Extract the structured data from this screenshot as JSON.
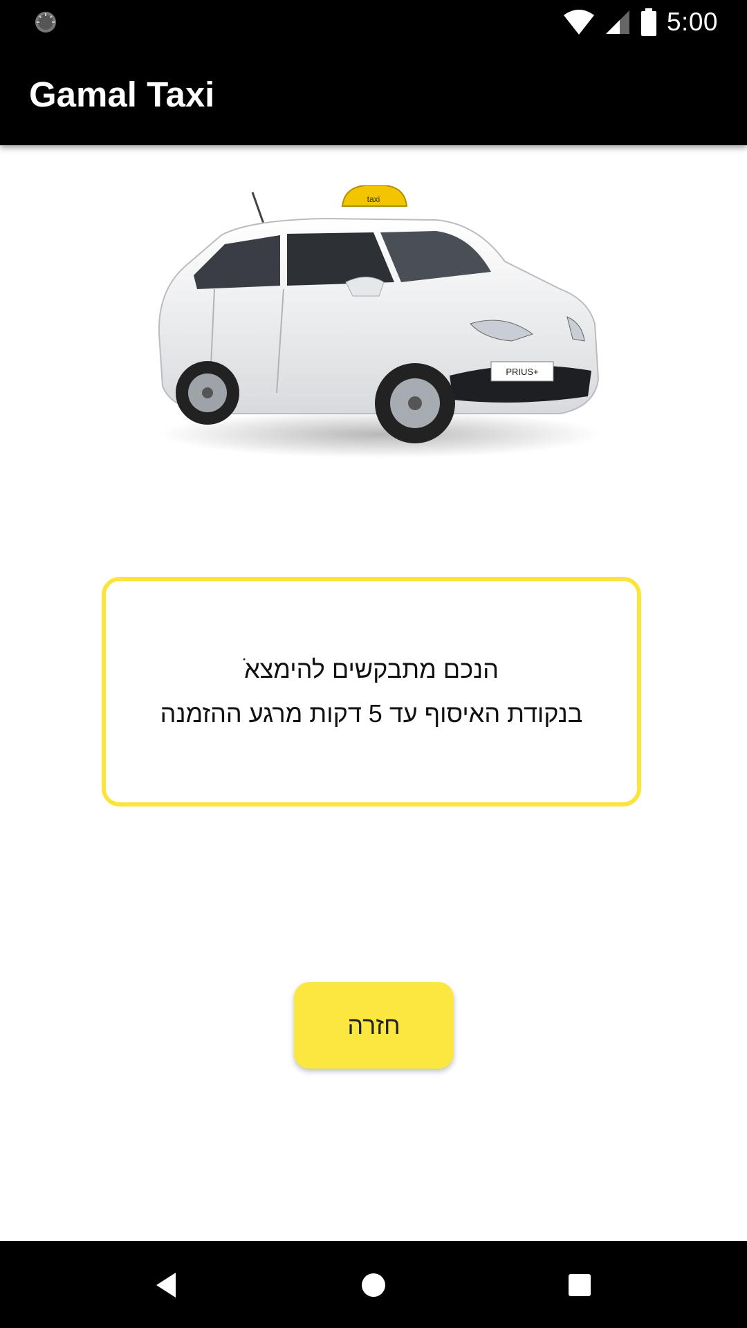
{
  "status_bar": {
    "time": "5:00",
    "icons": [
      "loading-icon",
      "wifi-icon",
      "signal-icon",
      "battery-icon"
    ]
  },
  "app_bar": {
    "title": "Gamal Taxi"
  },
  "car_image": {
    "roof_sign": "taxi",
    "plate": "PRIUS+"
  },
  "message": {
    "line1": "הנכם מתבקשים להימצאׁ",
    "line2": "בנקודת האיסוף עד 5 דקות מרגע ההזמנה",
    "border_color": "#fbe53b"
  },
  "back_button": {
    "label": "חזרה",
    "color": "#fbe73f"
  },
  "nav_bar": {
    "icons": [
      "back-triangle-icon",
      "home-circle-icon",
      "recents-square-icon"
    ]
  }
}
